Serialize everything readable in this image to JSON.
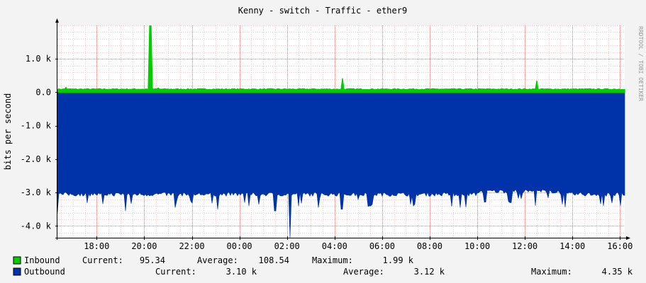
{
  "chart_data": {
    "type": "area",
    "title": "Kenny - switch - Traffic - ether9",
    "ylabel": "bits per second",
    "xlabel": "",
    "ylim": [
      -4350,
      2000
    ],
    "y_ticks": [
      "1.0 k",
      "0.0",
      "-1.0 k",
      "-2.0 k",
      "-3.0 k",
      "-4.0 k"
    ],
    "y_tick_values": [
      1000,
      0,
      -1000,
      -2000,
      -3000,
      -4000
    ],
    "x_ticks": [
      "18:00",
      "20:00",
      "22:00",
      "00:00",
      "02:00",
      "04:00",
      "06:00",
      "08:00",
      "10:00",
      "12:00",
      "14:00",
      "16:00"
    ],
    "x_tick_hours": [
      18,
      20,
      22,
      24,
      26,
      28,
      30,
      32,
      34,
      36,
      38,
      40
    ],
    "x_range_hours": [
      16.35,
      40.2
    ],
    "grid": true,
    "legend_position": "bottom",
    "watermark": "RRDTOOL / TOBI OETIKER",
    "series": [
      {
        "name": "Inbound",
        "color": "#00cc00",
        "baseline": 95,
        "spikes": [
          {
            "x": 16.7,
            "y": 150
          },
          {
            "x": 20.25,
            "y": 1990
          },
          {
            "x": 20.6,
            "y": 130
          },
          {
            "x": 28.35,
            "y": 420
          },
          {
            "x": 36.5,
            "y": 350
          }
        ],
        "stats": {
          "current": "95.34",
          "average": "108.54",
          "maximum": "1.99 k"
        }
      },
      {
        "name": "Outbound",
        "color": "#0033aa",
        "baseline": -3050,
        "dips": [
          {
            "x": 16.35,
            "y": -3600
          },
          {
            "x": 19.2,
            "y": -3550
          },
          {
            "x": 21.3,
            "y": -3450
          },
          {
            "x": 23.1,
            "y": -3500
          },
          {
            "x": 24.4,
            "y": -3400
          },
          {
            "x": 25.5,
            "y": -3550
          },
          {
            "x": 26.15,
            "y": -4350
          },
          {
            "x": 27.3,
            "y": -3450
          },
          {
            "x": 28.3,
            "y": -3500
          },
          {
            "x": 29.5,
            "y": -3400
          },
          {
            "x": 31.2,
            "y": -3350
          },
          {
            "x": 33.3,
            "y": -3450
          },
          {
            "x": 35.4,
            "y": -3300
          },
          {
            "x": 37.6,
            "y": -3350
          },
          {
            "x": 39.3,
            "y": -3400
          }
        ],
        "stats": {
          "current": "3.10 k",
          "average": "3.12 k",
          "maximum": "4.35 k"
        }
      }
    ]
  },
  "legend": {
    "current_label": "Current:",
    "average_label": "Average:",
    "maximum_label": "Maximum:"
  }
}
